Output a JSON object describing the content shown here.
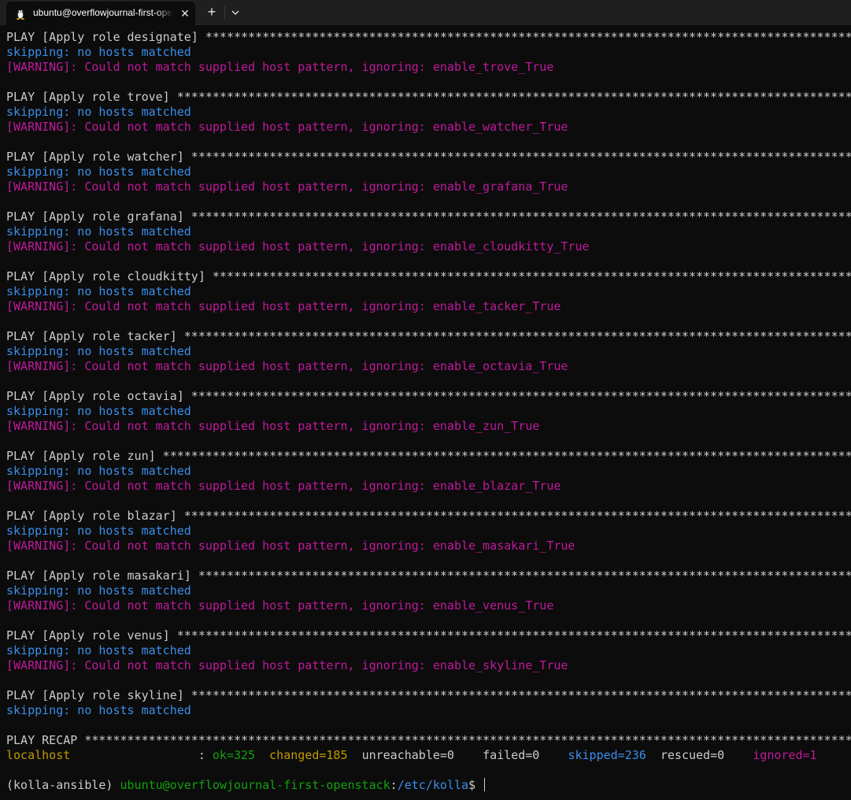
{
  "tab": {
    "icon": "linux-penguin-icon",
    "title": "ubuntu@overflowjournal-first-openstack",
    "close_label": "✕",
    "new_tab_label": "+",
    "dropdown_icon": "chevron-down-icon"
  },
  "plays": [
    {
      "header": "PLAY [Apply role designate] ***********************************************************************************************************",
      "skip": "skipping: no hosts matched",
      "warning": "[WARNING]: Could not match supplied host pattern, ignoring: enable_trove_True"
    },
    {
      "header": "PLAY [Apply role trove] ***************************************************************************************************************",
      "skip": "skipping: no hosts matched",
      "warning": "[WARNING]: Could not match supplied host pattern, ignoring: enable_watcher_True"
    },
    {
      "header": "PLAY [Apply role watcher] *************************************************************************************************************",
      "skip": "skipping: no hosts matched",
      "warning": "[WARNING]: Could not match supplied host pattern, ignoring: enable_grafana_True"
    },
    {
      "header": "PLAY [Apply role grafana] *************************************************************************************************************",
      "skip": "skipping: no hosts matched",
      "warning": "[WARNING]: Could not match supplied host pattern, ignoring: enable_cloudkitty_True"
    },
    {
      "header": "PLAY [Apply role cloudkitty] **********************************************************************************************************",
      "skip": "skipping: no hosts matched",
      "warning": "[WARNING]: Could not match supplied host pattern, ignoring: enable_tacker_True"
    },
    {
      "header": "PLAY [Apply role tacker] **************************************************************************************************************",
      "skip": "skipping: no hosts matched",
      "warning": "[WARNING]: Could not match supplied host pattern, ignoring: enable_octavia_True"
    },
    {
      "header": "PLAY [Apply role octavia] *************************************************************************************************************",
      "skip": "skipping: no hosts matched",
      "warning": "[WARNING]: Could not match supplied host pattern, ignoring: enable_zun_True"
    },
    {
      "header": "PLAY [Apply role zun] *****************************************************************************************************************",
      "skip": "skipping: no hosts matched",
      "warning": "[WARNING]: Could not match supplied host pattern, ignoring: enable_blazar_True"
    },
    {
      "header": "PLAY [Apply role blazar] **************************************************************************************************************",
      "skip": "skipping: no hosts matched",
      "warning": "[WARNING]: Could not match supplied host pattern, ignoring: enable_masakari_True"
    },
    {
      "header": "PLAY [Apply role masakari] ************************************************************************************************************",
      "skip": "skipping: no hosts matched",
      "warning": "[WARNING]: Could not match supplied host pattern, ignoring: enable_venus_True"
    },
    {
      "header": "PLAY [Apply role venus] ***************************************************************************************************************",
      "skip": "skipping: no hosts matched",
      "warning": "[WARNING]: Could not match supplied host pattern, ignoring: enable_skyline_True"
    },
    {
      "header": "PLAY [Apply role skyline] *************************************************************************************************************",
      "skip": "skipping: no hosts matched",
      "warning": ""
    }
  ],
  "recap": {
    "header": "PLAY RECAP ****************************************************************************************************************************",
    "host": "localhost",
    "sep": ": ",
    "ok": "ok=325",
    "changed": "changed=185",
    "unreachable": "unreachable=0",
    "failed": "failed=0",
    "skipped": "skipped=236",
    "rescued": "rescued=0",
    "ignored": "ignored=1"
  },
  "prompt": {
    "venv": "(kolla-ansible) ",
    "user_host": "ubuntu@overflowjournal-first-openstack",
    "colon": ":",
    "path": "/etc/kolla",
    "symbol": "$ "
  },
  "colors": {
    "background": "#0c0c0c",
    "skip_blue": "#3b8eea",
    "warning_magenta": "#c0199c",
    "ok_green": "#13a10e",
    "changed_yellow": "#c19c00"
  }
}
